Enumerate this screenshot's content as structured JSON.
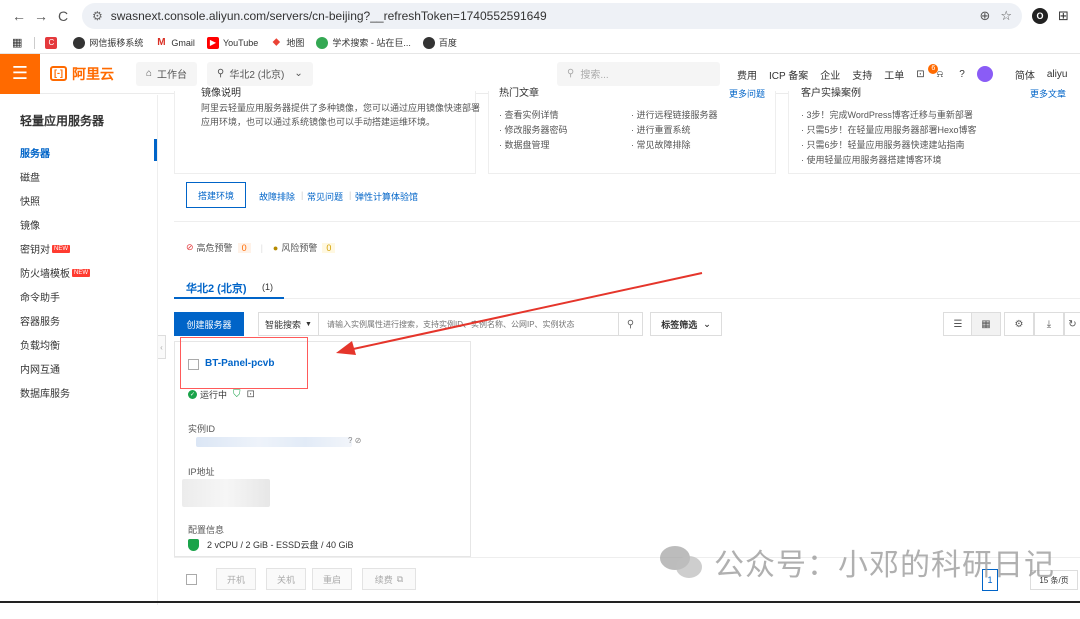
{
  "browser": {
    "url": "swasnext.console.aliyun.com/servers/cn-beijing?__refreshToken=1740552591649",
    "bookmarks": [
      "网信振移系统",
      "Gmail",
      "YouTube",
      "地图",
      "学术搜索 - 站在巨...",
      "百度"
    ]
  },
  "topnav": {
    "logo": "阿里云",
    "workbench": "工作台",
    "region": "华北2 (北京)",
    "search_placeholder": "搜索...",
    "links": [
      "费用",
      "ICP 备案",
      "企业",
      "支持",
      "工单"
    ],
    "notification_count": "6",
    "lang": "简体",
    "user": "aliyu"
  },
  "sidebar": {
    "title": "轻量应用服务器",
    "items": [
      {
        "label": "服务器",
        "active": true,
        "new": false
      },
      {
        "label": "磁盘",
        "active": false,
        "new": false
      },
      {
        "label": "快照",
        "active": false,
        "new": false
      },
      {
        "label": "镜像",
        "active": false,
        "new": false
      },
      {
        "label": "密钥对",
        "active": false,
        "new": true
      },
      {
        "label": "防火墙模板",
        "active": false,
        "new": true
      },
      {
        "label": "命令助手",
        "active": false,
        "new": false
      },
      {
        "label": "容器服务",
        "active": false,
        "new": false
      },
      {
        "label": "负载均衡",
        "active": false,
        "new": false
      },
      {
        "label": "内网互通",
        "active": false,
        "new": false
      },
      {
        "label": "数据库服务",
        "active": false,
        "new": false
      }
    ],
    "new_tag": "NEW"
  },
  "intro": {
    "heading_cut": "镜像说明",
    "text": "阿里云轻量应用服务器提供了多种镜像，您可以通过应用镜像快速部署应用环境，也可以通过系统镜像也可以手动搭建运维环境。",
    "env_button": "搭建环境",
    "doc_links": [
      "故障排除",
      "常见问题",
      "弹性计算体验馆"
    ]
  },
  "hot_docs": {
    "title": "热门文章",
    "more": "更多问题",
    "left": [
      "查看实例详情",
      "修改服务器密码",
      "数据盘管理"
    ],
    "right": [
      "进行远程链接服务器",
      "进行重置系统",
      "常见故障排除"
    ]
  },
  "cases": {
    "title": "客户实操案例",
    "more": "更多文章",
    "items": [
      "3步！完成WordPress博客迁移与重新部署",
      "只需5步！在轻量应用服务器部署Hexo博客",
      "只需6步！轻量应用服务器快速建站指南",
      "使用轻量应用服务器搭建博客环境"
    ]
  },
  "alerts": {
    "high_label": "高危预警",
    "high_count": "0",
    "risk_label": "风险预警",
    "risk_count": "0"
  },
  "region_tab": {
    "label": "华北2 (北京)",
    "count": "(1)"
  },
  "toolbar": {
    "create": "创建服务器",
    "smart_search": "智能搜索",
    "search_placeholder": "请输入实例属性进行搜索，支持实例ID、实例名称、公网IP、实例状态",
    "tag_filter": "标签筛选"
  },
  "instance": {
    "name": "BT-Panel-pcvb",
    "status": "运行中",
    "id_label": "实例ID",
    "ip_label": "IP地址",
    "config_label": "配置信息",
    "config": "2 vCPU / 2 GiB - ESSD云盘 / 40 GiB"
  },
  "bottom": {
    "buttons": [
      "开机",
      "关机",
      "重启",
      "续费"
    ],
    "page": "1",
    "per_page": "15 条/页"
  },
  "watermark": "公众号：小邓的科研日记",
  "icons": {
    "back": "←",
    "forward": "→",
    "reload": "C",
    "menu": "☰",
    "search": "⚲",
    "home": "⌂",
    "location": "⚲",
    "zoom": "⊕",
    "star": "☆",
    "chevron": "⌄",
    "list_view": "☰",
    "grid_view": "▦",
    "settings": "⚙",
    "download": "⤓",
    "refresh": "↻"
  }
}
